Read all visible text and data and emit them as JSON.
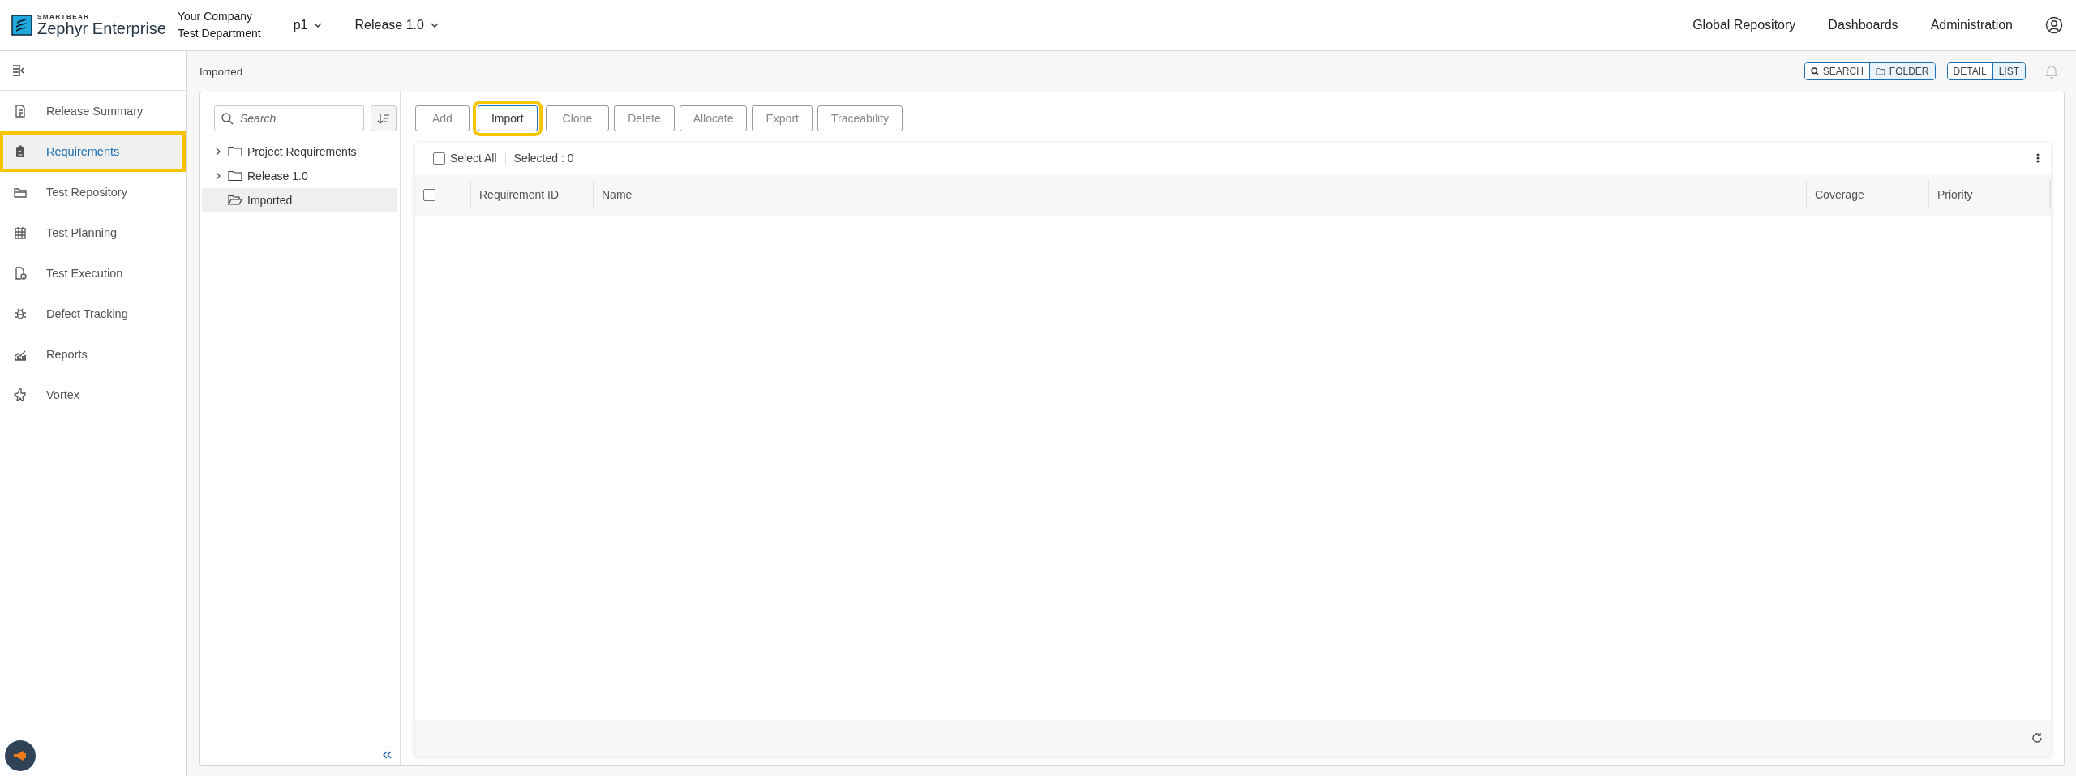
{
  "header": {
    "logo_small": "SMARTBEAR",
    "logo_name": "Zephyr Enterprise",
    "company": "Your Company",
    "department": "Test Department",
    "project": "p1",
    "release": "Release 1.0",
    "nav": [
      "Global Repository",
      "Dashboards",
      "Administration"
    ]
  },
  "sidebar": {
    "items": [
      {
        "label": "Release Summary",
        "selected": false,
        "highlighted": false
      },
      {
        "label": "Requirements",
        "selected": true,
        "highlighted": true
      },
      {
        "label": "Test Repository",
        "selected": false,
        "highlighted": false
      },
      {
        "label": "Test Planning",
        "selected": false,
        "highlighted": false
      },
      {
        "label": "Test Execution",
        "selected": false,
        "highlighted": false
      },
      {
        "label": "Defect Tracking",
        "selected": false,
        "highlighted": false
      },
      {
        "label": "Reports",
        "selected": false,
        "highlighted": false
      },
      {
        "label": "Vortex",
        "selected": false,
        "highlighted": false
      }
    ]
  },
  "breadcrumb": "Imported",
  "view_toggles": [
    [
      {
        "label": "SEARCH",
        "kind": "search",
        "selected": false
      },
      {
        "label": "FOLDER",
        "kind": "folder",
        "selected": true
      }
    ],
    [
      {
        "label": "DETAIL",
        "kind": "plain",
        "selected": false
      },
      {
        "label": "LIST",
        "kind": "plain",
        "selected": true
      }
    ]
  ],
  "tree": {
    "search": {
      "placeholder": "Search"
    },
    "items": [
      {
        "label": "Project Requirements",
        "kind": "branch",
        "selected": false
      },
      {
        "label": "Release 1.0",
        "kind": "branch",
        "selected": false
      },
      {
        "label": "Imported",
        "kind": "leaf",
        "selected": true
      }
    ]
  },
  "toolbar": [
    {
      "label": "Add",
      "highlighted": false,
      "emphasized": false
    },
    {
      "label": "Import",
      "highlighted": true,
      "emphasized": true
    },
    {
      "label": "Clone",
      "highlighted": false,
      "emphasized": false
    },
    {
      "label": "Delete",
      "highlighted": false,
      "emphasized": false
    },
    {
      "label": "Allocate",
      "highlighted": false,
      "emphasized": false
    },
    {
      "label": "Export",
      "highlighted": false,
      "emphasized": false
    },
    {
      "label": "Traceability",
      "highlighted": false,
      "emphasized": false
    }
  ],
  "grid": {
    "select_all": {
      "label": "Select All",
      "checked": false
    },
    "selected_count": "Selected : 0",
    "header_checked": false,
    "columns": [
      "Requirement ID",
      "Name",
      "Coverage",
      "Priority"
    ]
  }
}
